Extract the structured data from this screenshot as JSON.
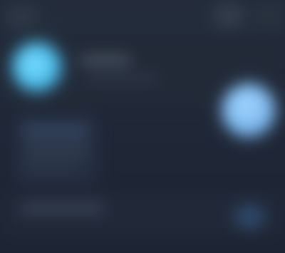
{
  "colors": {
    "background": "#1f2634",
    "accent_blue": "#56c4ef",
    "status_blue": "#7db9ef"
  }
}
